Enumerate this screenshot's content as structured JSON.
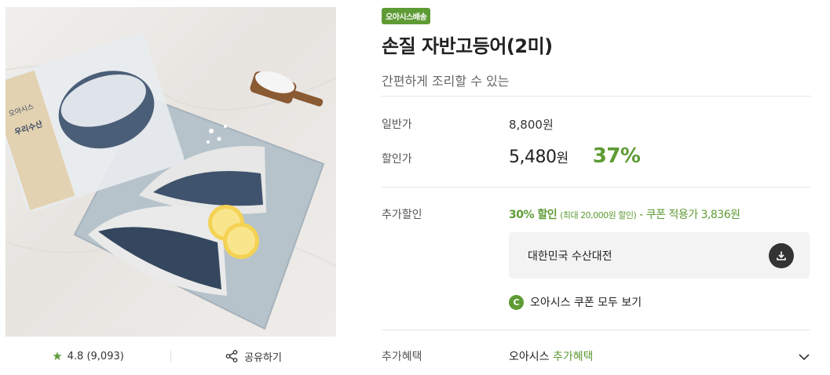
{
  "product": {
    "badge": "오아시스배송",
    "title": "손질 자반고등어(2미)",
    "subtitle": "간편하게 조리할 수 있는",
    "rating": "4.8 (9,093)",
    "share_label": "공유하기",
    "image_alt": "손질 자반고등어"
  },
  "pricing": {
    "regular_label": "일반가",
    "regular_price": "8,800원",
    "sale_label": "할인가",
    "sale_amount": "5,480",
    "sale_unit": "원",
    "discount_rate": "37%"
  },
  "extra_discount": {
    "label": "추가할인",
    "rate": "30% 할인",
    "limit": "(최대 20,000원 할인)",
    "rest": " - 쿠폰 적용가 3,836원",
    "coupon_name": "대한민국 수산대전",
    "view_all_icon": "C",
    "view_all_label": "오아시스 쿠폰 모두 보기"
  },
  "extra_benefit": {
    "label": "추가혜택",
    "prefix": "오아시스",
    "highlight": "추가혜택"
  },
  "colors": {
    "accent": "#5e9b35",
    "text": "#222222",
    "muted": "#666666",
    "panel": "#f3f3f3"
  },
  "icons": [
    "star-icon",
    "share-icon",
    "download-icon",
    "chevron-down-icon"
  ]
}
